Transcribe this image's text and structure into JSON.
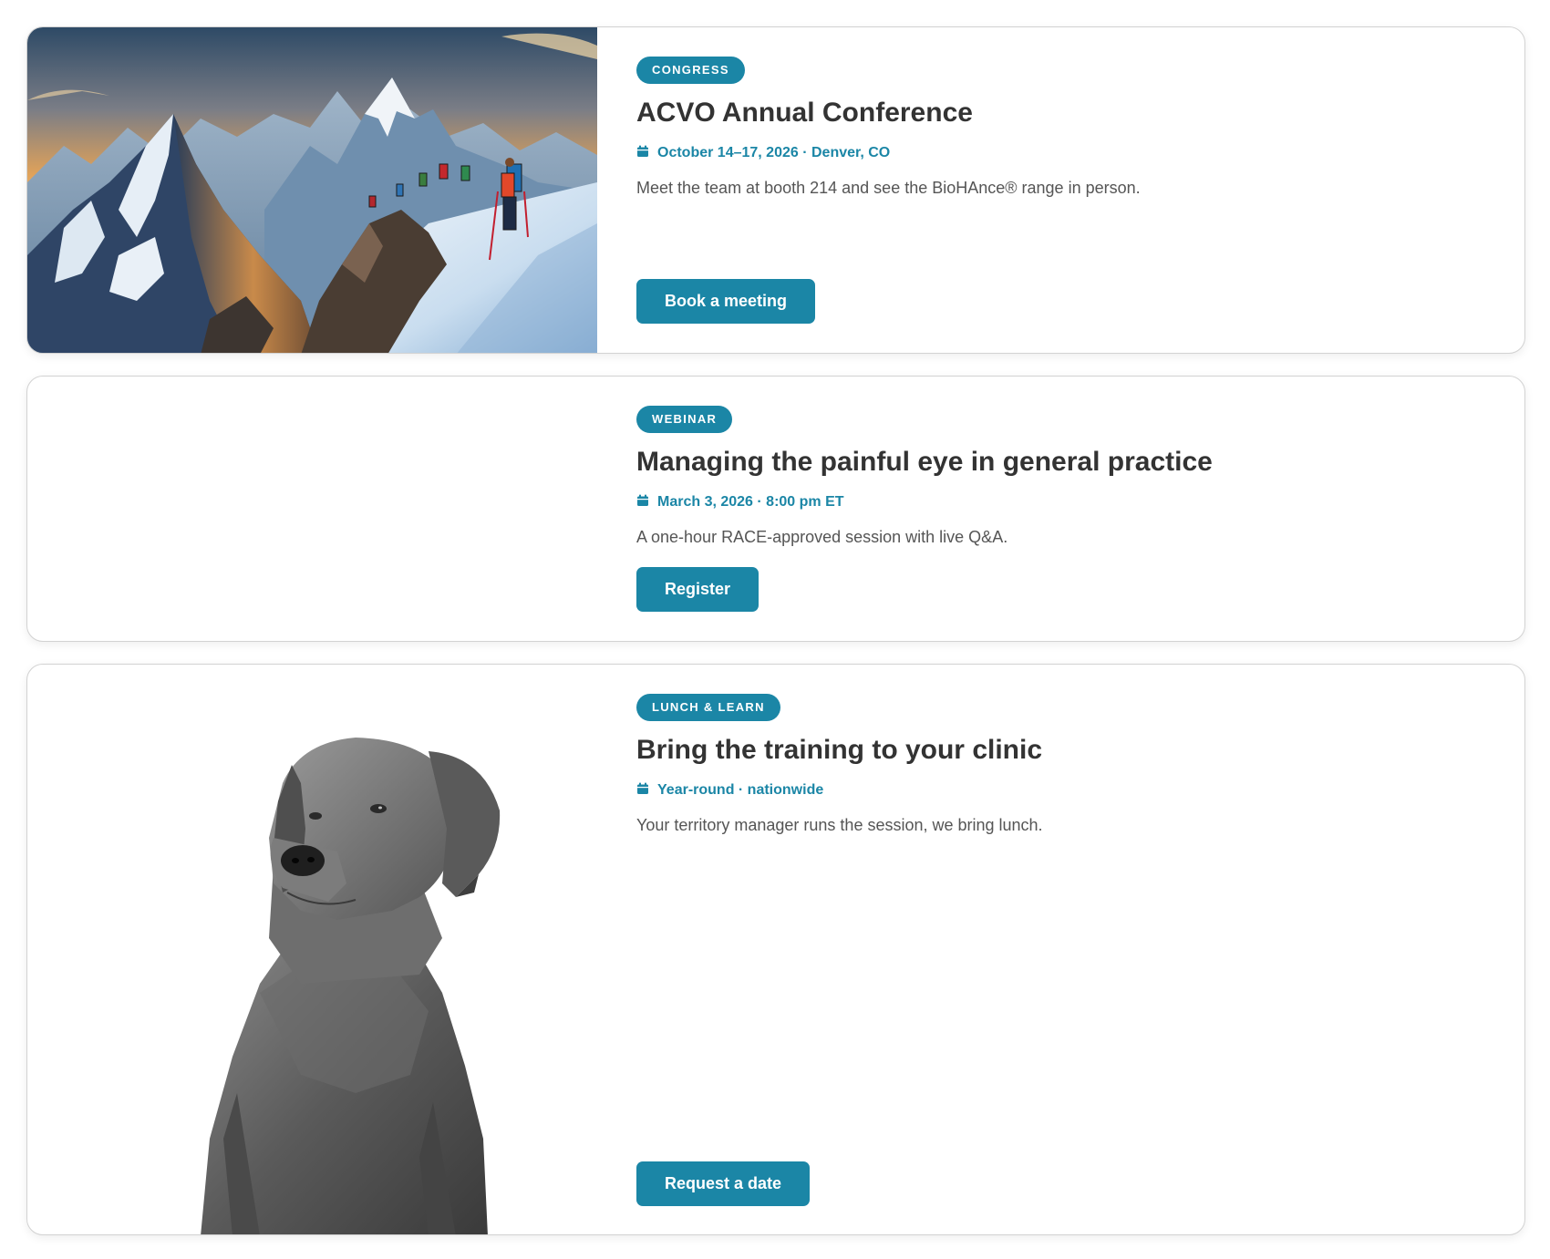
{
  "events": [
    {
      "badge": "CONGRESS",
      "title": "ACVO Annual Conference",
      "meta": "October 14–17, 2026 · Denver, CO",
      "description": "Meet the team at booth 214 and see the BioHAnce® range in person.",
      "button": "Book a meeting",
      "image": "mountain-climbers-image"
    },
    {
      "badge": "WEBINAR",
      "title": "Managing the painful eye in general practice",
      "meta": "March 3, 2026 · 8:00 pm ET",
      "description": "A one-hour RACE-approved session with live Q&A.",
      "button": "Register",
      "image": ""
    },
    {
      "badge": "LUNCH & LEARN",
      "title": "Bring the training to your clinic",
      "meta": "Year-round · nationwide",
      "description": "Your territory manager runs the session, we bring lunch.",
      "button": "Request a date",
      "image": "dog-portrait-image"
    }
  ],
  "icons": {
    "meta_icon": "calendar-icon"
  },
  "colors": {
    "accent": "#1b86a6",
    "title_text": "#333333",
    "body_text": "#555555",
    "card_border": "#d2d2d2"
  }
}
